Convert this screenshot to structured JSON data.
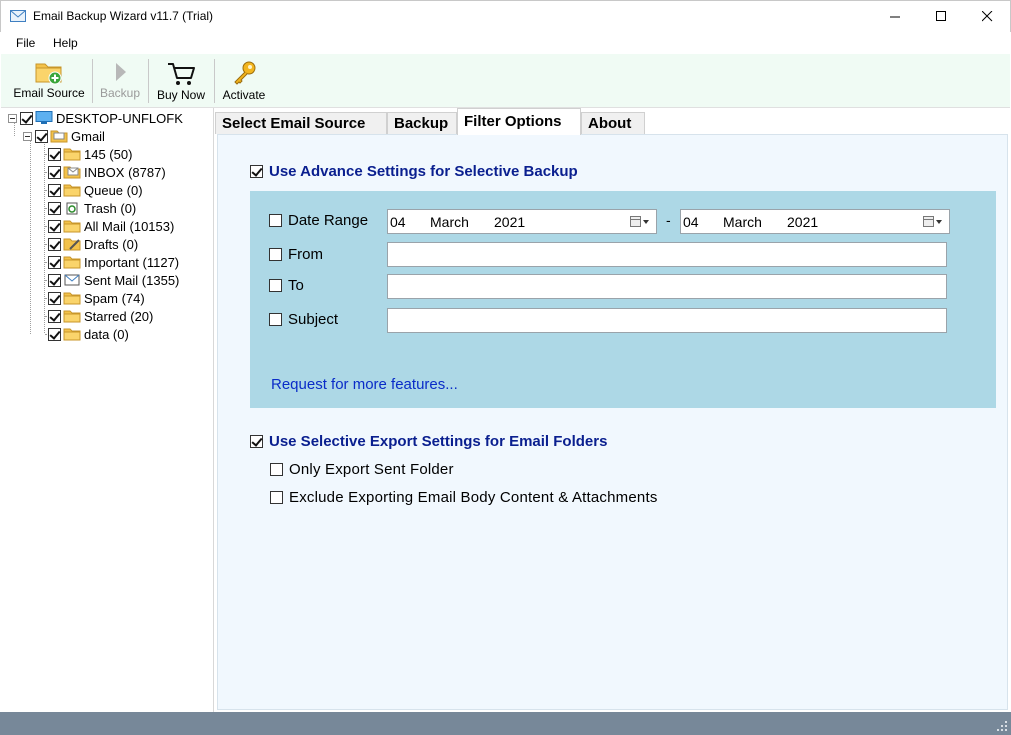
{
  "window": {
    "title": "Email Backup Wizard v11.7 (Trial)"
  },
  "menu": {
    "file": "File",
    "help": "Help"
  },
  "toolbar": {
    "email_source": "Email Source",
    "backup": "Backup",
    "buy_now": "Buy Now",
    "activate": "Activate"
  },
  "tree": {
    "root": "DESKTOP-UNFLOFK",
    "account": "Gmail",
    "folders": [
      {
        "label": "145 (50)",
        "icon": "folder-icon"
      },
      {
        "label": "INBOX (8787)",
        "icon": "inbox-folder-icon"
      },
      {
        "label": "Queue (0)",
        "icon": "folder-icon"
      },
      {
        "label": "Trash (0)",
        "icon": "trash-folder-icon"
      },
      {
        "label": "All Mail (10153)",
        "icon": "folder-icon"
      },
      {
        "label": "Drafts (0)",
        "icon": "drafts-folder-icon"
      },
      {
        "label": "Important (1127)",
        "icon": "folder-icon"
      },
      {
        "label": "Sent Mail (1355)",
        "icon": "sent-folder-icon"
      },
      {
        "label": "Spam (74)",
        "icon": "folder-icon"
      },
      {
        "label": "Starred (20)",
        "icon": "folder-icon"
      },
      {
        "label": "data (0)",
        "icon": "folder-icon"
      }
    ]
  },
  "tabs": [
    {
      "label": "Select Email Source"
    },
    {
      "label": "Backup"
    },
    {
      "label": "Filter Options"
    },
    {
      "label": "About"
    }
  ],
  "filter": {
    "advance_label": "Use Advance Settings for Selective Backup",
    "date_range_label": "Date Range",
    "date_from": {
      "day": "04",
      "month": "March",
      "year": "2021"
    },
    "date_sep": "-",
    "date_to": {
      "day": "04",
      "month": "March",
      "year": "2021"
    },
    "from_label": "From",
    "from_value": "",
    "to_label": "To",
    "to_value": "",
    "subject_label": "Subject",
    "subject_value": "",
    "request_link": "Request for more features...",
    "export_label": "Use Selective Export Settings for Email Folders",
    "only_sent_label": "Only Export Sent Folder",
    "exclude_body_label": "Exclude Exporting Email Body Content & Attachments"
  },
  "colors": {
    "toolbar_bg": "#f0fbf4",
    "filter_box_bg": "#add8e6",
    "tab_body_bg": "#f1f8fe",
    "heading_text": "#0a1f8f",
    "link_text": "#0a2cc8",
    "statusbar_bg": "#778899"
  }
}
